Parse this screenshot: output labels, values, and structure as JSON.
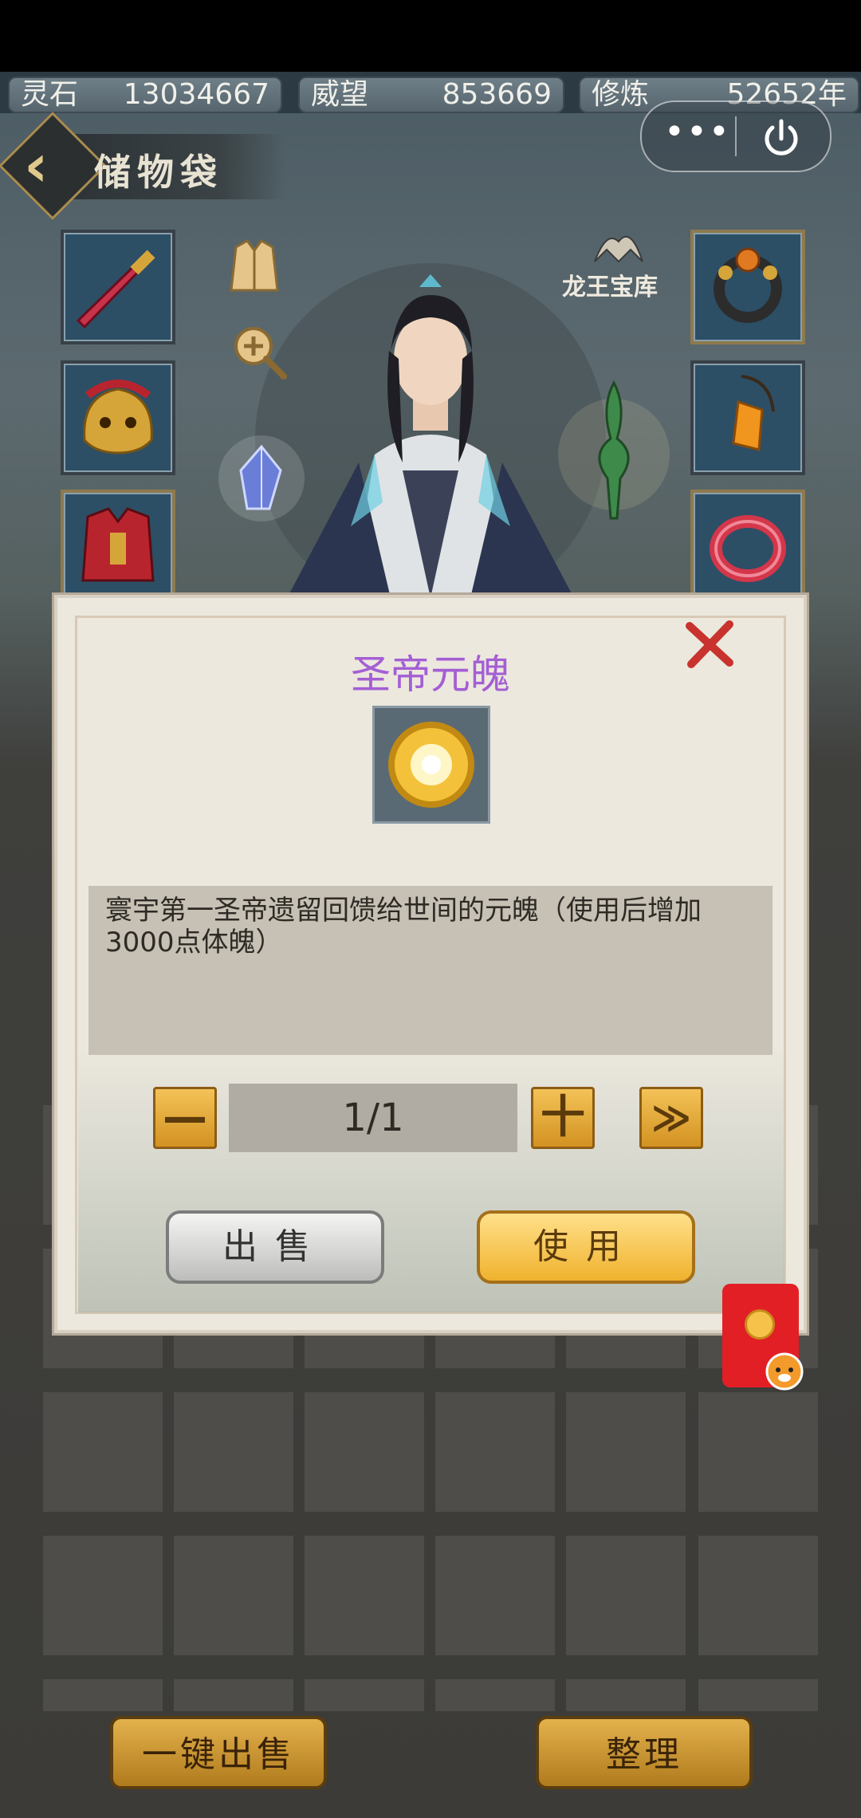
{
  "resources": [
    {
      "label": "灵石",
      "value": "13034667"
    },
    {
      "label": "威望",
      "value": "853669"
    },
    {
      "label": "修炼",
      "value": "52652年"
    }
  ],
  "capsule": {
    "more_label": "•••"
  },
  "header": {
    "title": "储物袋"
  },
  "treasury": {
    "label": "龙王宝库"
  },
  "item": {
    "name": "圣帝元魄",
    "description": "寰宇第一圣帝遗留回馈给世间的元魄（使用后增加3000点体魄）"
  },
  "quantity": {
    "display": "1/1"
  },
  "controls": {
    "minus": "—",
    "plus": "十",
    "max": "≫"
  },
  "actions": {
    "sell": "出售",
    "use": "使用"
  },
  "bottom": {
    "sell_all": "一键出售",
    "organize": "整理"
  }
}
